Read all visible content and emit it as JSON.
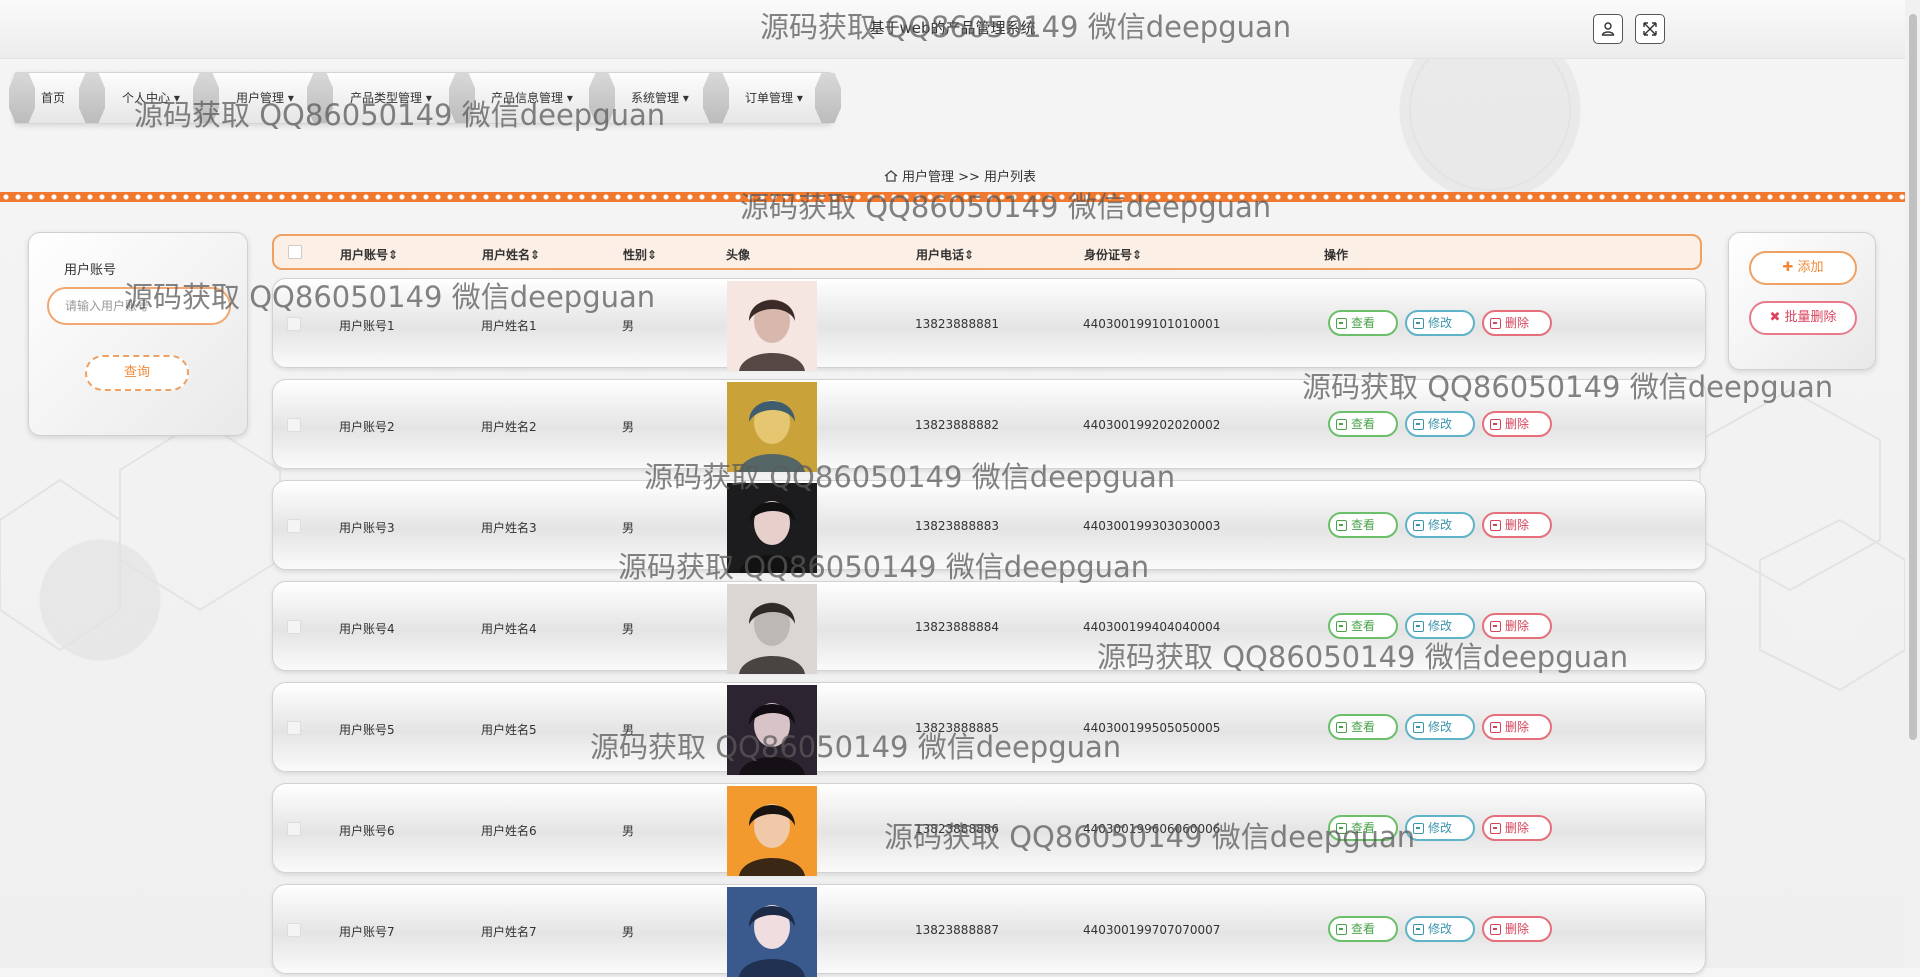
{
  "header": {
    "title": "基于web的产品管理系统",
    "user_icon": "user-icon",
    "fullscreen_icon": "fullscreen-icon"
  },
  "nav": {
    "items": [
      {
        "label": "首页"
      },
      {
        "label": "个人中心 ▾"
      },
      {
        "label": "用户管理 ▾"
      },
      {
        "label": "产品类型管理 ▾"
      },
      {
        "label": "产品信息管理 ▾"
      },
      {
        "label": "系统管理 ▾"
      },
      {
        "label": "订单管理 ▾"
      }
    ]
  },
  "breadcrumb": {
    "home_icon": "home-icon",
    "text": "用户管理 >> 用户列表"
  },
  "search": {
    "label": "用户账号",
    "placeholder": "请输入用户账号",
    "button_label": "查询"
  },
  "actions": {
    "add_label": "✚ 添加",
    "batch_delete_label": "✖ 批量删除"
  },
  "table": {
    "columns": {
      "account": "用户账号⇕",
      "name": "用户姓名⇕",
      "gender": "性别⇕",
      "avatar": "头像",
      "phone": "用户电话⇕",
      "id_card": "身份证号⇕",
      "ops": "操作"
    },
    "op_labels": {
      "view": "查看",
      "edit": "修改",
      "delete": "删除"
    },
    "rows": [
      {
        "account": "用户账号1",
        "name": "用户姓名1",
        "gender": "男",
        "phone": "13823888881",
        "id_card": "440300199101010001",
        "avatar_colors": [
          "#f6e6e2",
          "#d8b8ac",
          "#3a2a28"
        ]
      },
      {
        "account": "用户账号2",
        "name": "用户姓名2",
        "gender": "男",
        "phone": "13823888882",
        "id_card": "440300199202020002",
        "avatar_colors": [
          "#c9a23a",
          "#e5c772",
          "#3f5d6e"
        ]
      },
      {
        "account": "用户账号3",
        "name": "用户姓名3",
        "gender": "男",
        "phone": "13823888883",
        "id_card": "440300199303030003",
        "avatar_colors": [
          "#1c1c1e",
          "#e7d0cc",
          "#111111"
        ]
      },
      {
        "account": "用户账号4",
        "name": "用户姓名4",
        "gender": "男",
        "phone": "13823888884",
        "id_card": "440300199404040004",
        "avatar_colors": [
          "#d9d6d4",
          "#bdb8b6",
          "#2f2a28"
        ]
      },
      {
        "account": "用户账号5",
        "name": "用户姓名5",
        "gender": "男",
        "phone": "13823888885",
        "id_card": "440300199505050005",
        "avatar_colors": [
          "#2c2430",
          "#d8c4c8",
          "#120d12"
        ]
      },
      {
        "account": "用户账号6",
        "name": "用户姓名6",
        "gender": "男",
        "phone": "13823888886",
        "id_card": "440300199606060006",
        "avatar_colors": [
          "#f29a2e",
          "#f0c9a8",
          "#1a1410"
        ]
      },
      {
        "account": "用户账号7",
        "name": "用户姓名7",
        "gender": "男",
        "phone": "13823888887",
        "id_card": "440300199707070007",
        "avatar_colors": [
          "#3a5a8e",
          "#f0dde0",
          "#1d2a46"
        ]
      }
    ]
  },
  "watermark": {
    "text": "源码获取 QQ86050149 微信deepguan"
  },
  "colors": {
    "accent": "#f0792f",
    "view": "#4aa34a",
    "edit": "#3c94ab",
    "delete": "#d2445a"
  }
}
